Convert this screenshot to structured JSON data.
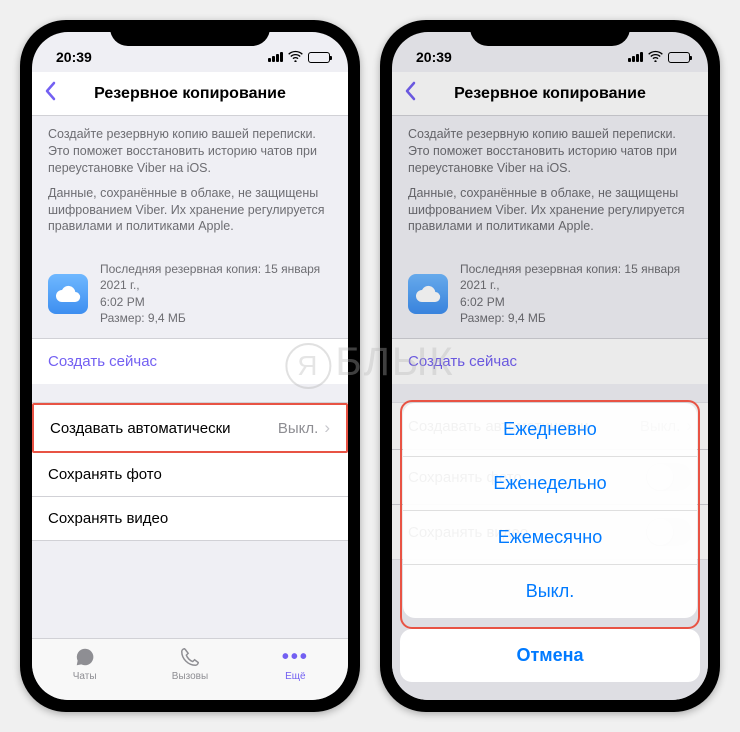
{
  "status": {
    "time": "20:39"
  },
  "header": {
    "title": "Резервное копирование"
  },
  "intro": {
    "p1": "Создайте резервную копию вашей переписки. Это поможет восстановить историю чатов при переустановке Viber на iOS.",
    "p2": "Данные, сохранённые в облаке, не защищены шифрованием Viber. Их хранение регулируется правилами и политиками Apple."
  },
  "backup": {
    "line1": "Последняя резервная копия: 15 января 2021 г.,",
    "line2": "6:02 PM",
    "line3": "Размер: 9,4 МБ"
  },
  "actions": {
    "create_now": "Создать сейчас"
  },
  "cells": {
    "auto": {
      "label": "Создавать автоматически",
      "value": "Выкл."
    },
    "photo": {
      "label": "Сохранять фото"
    },
    "video": {
      "label": "Сохранять видео"
    }
  },
  "tabs": {
    "chats": "Чаты",
    "calls": "Вызовы",
    "more": "Ещё"
  },
  "sheet": {
    "daily": "Ежедневно",
    "weekly": "Еженедельно",
    "monthly": "Ежемесячно",
    "off": "Выкл.",
    "cancel": "Отмена"
  },
  "watermark": "БЛЫК"
}
